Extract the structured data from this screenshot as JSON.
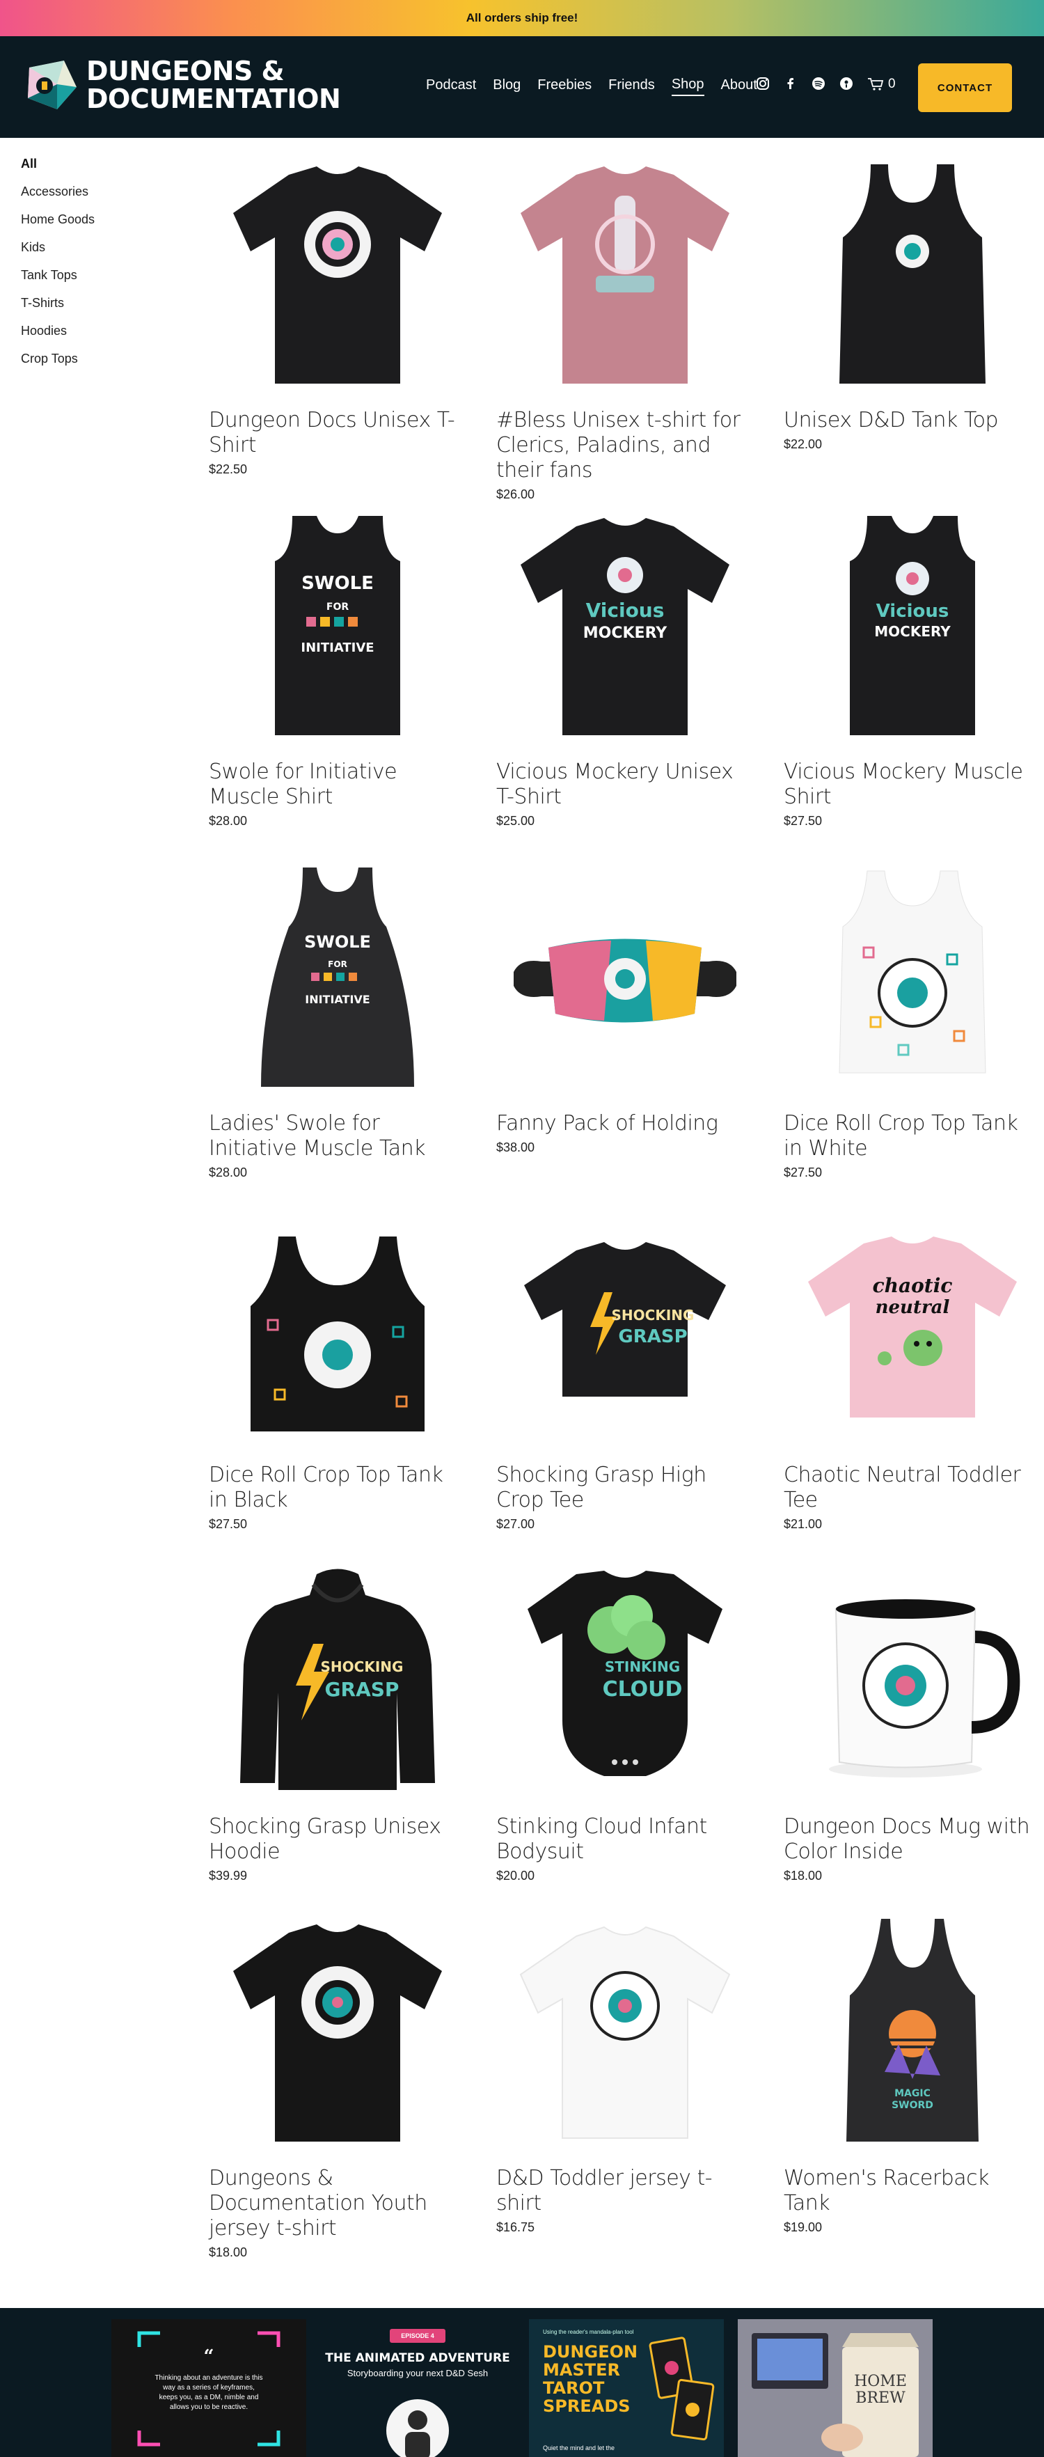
{
  "announcement": "All orders ship free!",
  "logo": {
    "line1": "DUNGEONS &",
    "line2": "DOCUMENTATION"
  },
  "nav": {
    "items": [
      "Podcast",
      "Blog",
      "Freebies",
      "Friends",
      "Shop",
      "About"
    ],
    "active": "Shop"
  },
  "social": [
    "instagram-icon",
    "facebook-icon",
    "spotify-icon",
    "podcast-icon"
  ],
  "cart": {
    "count": "0"
  },
  "contact_label": "CONTACT",
  "sidebar": {
    "items": [
      "All",
      "Accessories",
      "Home Goods",
      "Kids",
      "Tank Tops",
      "T-Shirts",
      "Hoodies",
      "Crop Tops"
    ],
    "active": "All"
  },
  "products": [
    {
      "title": "Dungeon Docs Unisex T-Shirt",
      "price": "$22.50"
    },
    {
      "title": "#Bless Unisex t-shirt for Clerics, Paladins, and their fans",
      "price": "$26.00"
    },
    {
      "title": "Unisex D&D Tank Top",
      "price": "$22.00"
    },
    {
      "title": "Swole for Initiative Muscle Shirt",
      "price": "$28.00"
    },
    {
      "title": "Vicious Mockery Unisex T-Shirt",
      "price": "$25.00"
    },
    {
      "title": "Vicious Mockery Muscle Shirt",
      "price": "$27.50"
    },
    {
      "title": "Ladies' Swole for Initiative Muscle Tank",
      "price": "$28.00"
    },
    {
      "title": "Fanny Pack of Holding",
      "price": "$38.00"
    },
    {
      "title": "Dice Roll Crop Top Tank in White",
      "price": "$27.50"
    },
    {
      "title": "Dice Roll Crop Top Tank in Black",
      "price": "$27.50"
    },
    {
      "title": "Shocking Grasp High Crop Tee",
      "price": "$27.00"
    },
    {
      "title": "Chaotic Neutral Toddler Tee",
      "price": "$21.00"
    },
    {
      "title": "Shocking Grasp Unisex Hoodie",
      "price": "$39.99"
    },
    {
      "title": "Stinking Cloud Infant Bodysuit",
      "price": "$20.00"
    },
    {
      "title": "Dungeon Docs Mug with Color Inside",
      "price": "$18.00"
    },
    {
      "title": "Dungeons & Documentation Youth jersey t-shirt",
      "price": "$18.00"
    },
    {
      "title": "D&D Toddler jersey t-shirt",
      "price": "$16.75"
    },
    {
      "title": "Women's Racerback Tank",
      "price": "$19.00"
    }
  ],
  "footer_thumbs": {
    "thumb1": {
      "quote": "Thinking about an adventure is this way as a series of keyframes, keeps you, as a DM, nimble and allows you to be reactive."
    },
    "thumb2": {
      "badge": "EPISODE 4",
      "title": "THE ANIMATED ADVENTURE",
      "subtitle": "Storyboarding your next D&D Sesh"
    },
    "thumb3": {
      "top": "Using the reader's mandala-plan tool",
      "title": "DUNGEON MASTER TAROT SPREADS",
      "bottom": "Quiet the mind and let the"
    },
    "thumb4": {
      "label": "HOME BREW"
    }
  }
}
